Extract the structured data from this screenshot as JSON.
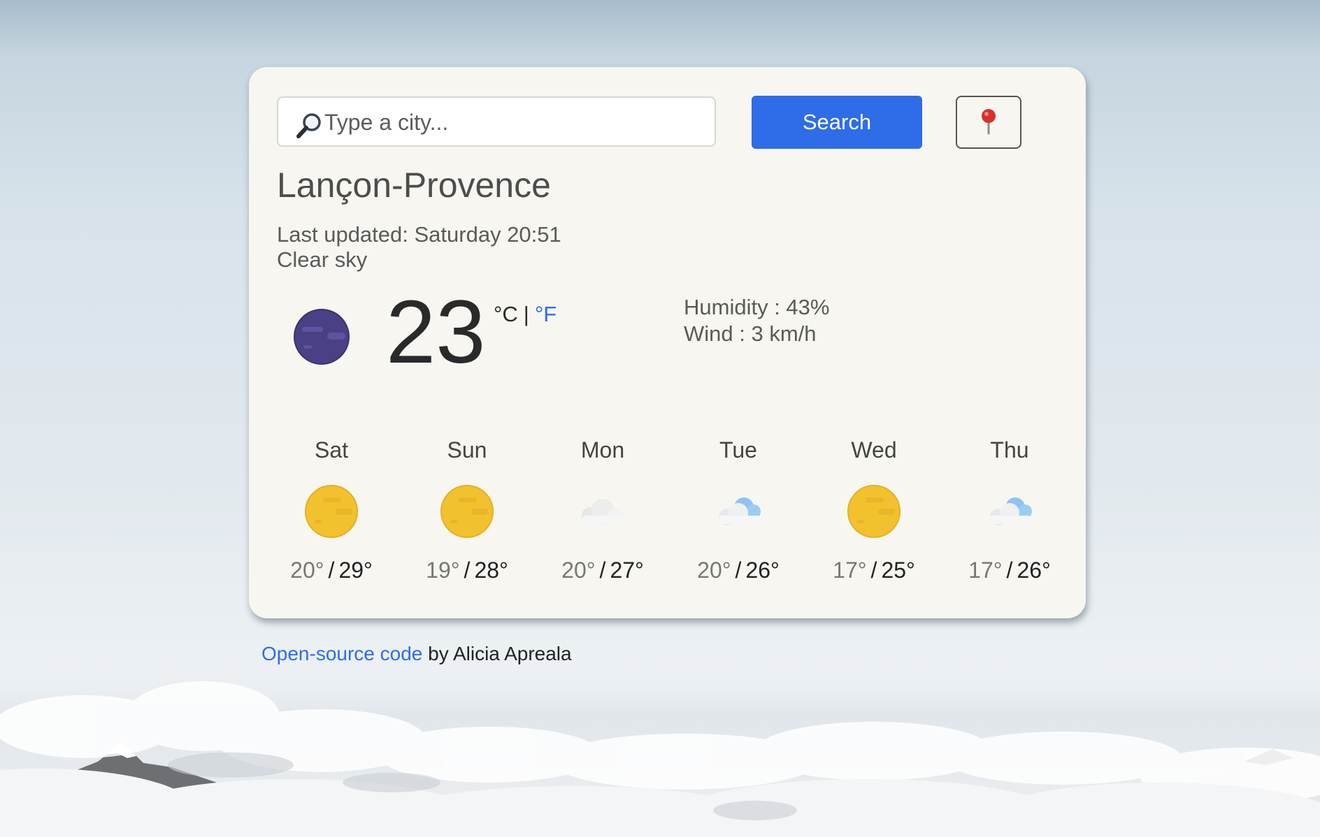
{
  "search": {
    "placeholder": "Type a city...",
    "value": "",
    "button_label": "Search"
  },
  "location_button": {
    "icon": "pin-icon"
  },
  "current": {
    "city": "Lançon-Provence",
    "last_updated": "Last updated: Saturday 20:51",
    "description": "Clear sky",
    "icon": "moon-icon",
    "temperature": "23",
    "unit_c": "°C",
    "unit_separator": "|",
    "unit_f": "°F",
    "humidity": "Humidity : 43%",
    "wind": "Wind : 3 km/h"
  },
  "forecast": [
    {
      "day": "Sat",
      "icon": "sun-icon",
      "min": "20°",
      "max": "29°"
    },
    {
      "day": "Sun",
      "icon": "sun-icon",
      "min": "19°",
      "max": "28°"
    },
    {
      "day": "Mon",
      "icon": "cloud-icon",
      "min": "20°",
      "max": "27°"
    },
    {
      "day": "Tue",
      "icon": "partly-cloudy-icon",
      "min": "20°",
      "max": "26°"
    },
    {
      "day": "Wed",
      "icon": "sun-icon",
      "min": "17°",
      "max": "25°"
    },
    {
      "day": "Thu",
      "icon": "partly-cloudy-icon",
      "min": "17°",
      "max": "26°"
    }
  ],
  "temp_separator": "/",
  "footer": {
    "link_text": "Open-source code",
    "suffix": " by Alicia Apreala"
  },
  "colors": {
    "accent": "#2f6ce8",
    "card_background": "#f7f6f1",
    "moon": "#4a4085",
    "sun": "#f2c12e"
  }
}
